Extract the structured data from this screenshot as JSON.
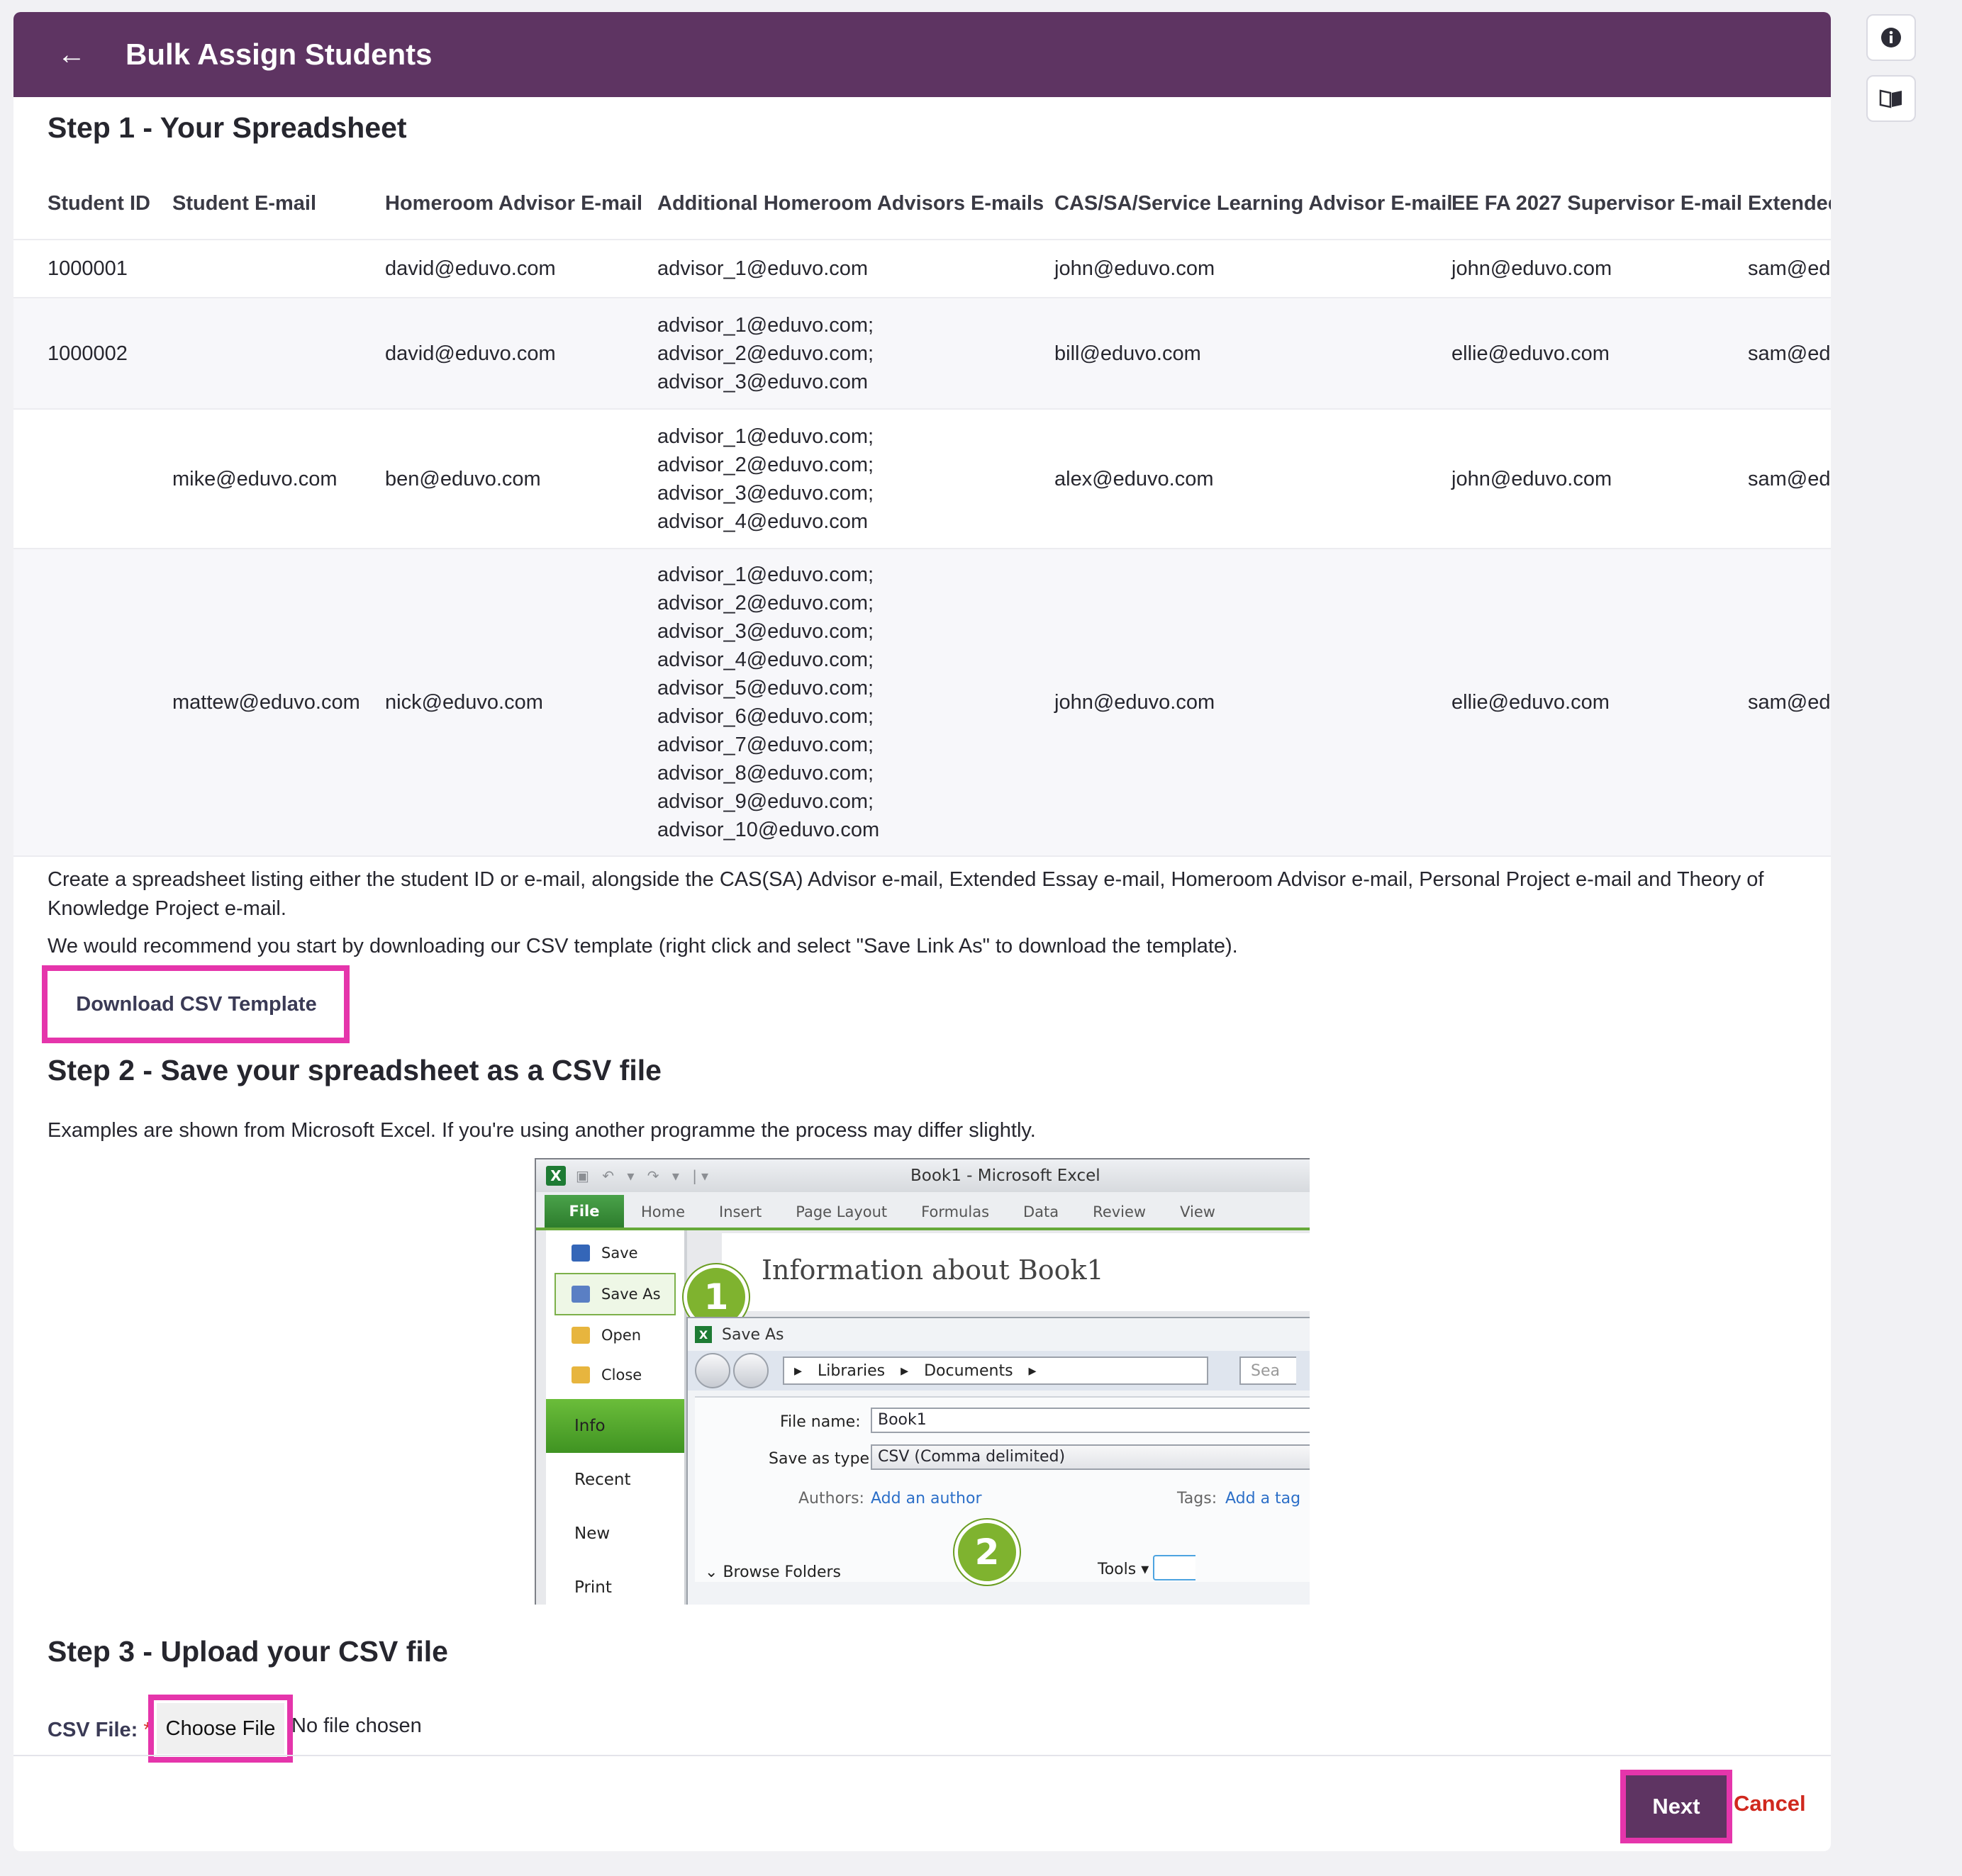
{
  "header": {
    "title": "Bulk Assign Students",
    "back_icon": "←"
  },
  "step1": {
    "title": "Step 1 - Your Spreadsheet"
  },
  "table": {
    "columns": [
      "Student ID",
      "Student E-mail",
      "Homeroom Advisor E-mail",
      "Additional Homeroom Advisors E-mails",
      "CAS/SA/Service Learning Advisor E-mail",
      "EE FA 2027 Supervisor E-mail",
      "Extended"
    ],
    "rows": [
      {
        "student_id": "1000001",
        "student_email": "",
        "homeroom": "david@eduvo.com",
        "additional": [
          "advisor_1@eduvo.com"
        ],
        "cas": "john@eduvo.com",
        "ee": "john@eduvo.com",
        "extended": "sam@edu"
      },
      {
        "student_id": "1000002",
        "student_email": "",
        "homeroom": "david@eduvo.com",
        "additional": [
          "advisor_1@eduvo.com;",
          "advisor_2@eduvo.com;",
          "advisor_3@eduvo.com"
        ],
        "cas": "bill@eduvo.com",
        "ee": "ellie@eduvo.com",
        "extended": "sam@edu"
      },
      {
        "student_id": "",
        "student_email": "mike@eduvo.com",
        "homeroom": "ben@eduvo.com",
        "additional": [
          "advisor_1@eduvo.com;",
          "advisor_2@eduvo.com;",
          "advisor_3@eduvo.com;",
          "advisor_4@eduvo.com"
        ],
        "cas": "alex@eduvo.com",
        "ee": "john@eduvo.com",
        "extended": "sam@edu"
      },
      {
        "student_id": "",
        "student_email": "mattew@eduvo.com",
        "homeroom": "nick@eduvo.com",
        "additional": [
          "advisor_1@eduvo.com;",
          "advisor_2@eduvo.com;",
          "advisor_3@eduvo.com;",
          "advisor_4@eduvo.com;",
          "advisor_5@eduvo.com;",
          "advisor_6@eduvo.com;",
          "advisor_7@eduvo.com;",
          "advisor_8@eduvo.com;",
          "advisor_9@eduvo.com;",
          "advisor_10@eduvo.com"
        ],
        "cas": "john@eduvo.com",
        "ee": "ellie@eduvo.com",
        "extended": "sam@edu"
      }
    ]
  },
  "instructions": {
    "p1": "Create a spreadsheet listing either the student ID or e-mail, alongside the CAS(SA) Advisor e-mail, Extended Essay e-mail, Homeroom Advisor e-mail, Personal Project e-mail and Theory of Knowledge Project e-mail.",
    "p2": "We would recommend you start by downloading our CSV template (right click and select \"Save Link As\" to download the template).",
    "download_label": "Download CSV Template"
  },
  "step2": {
    "title": "Step 2 - Save your spreadsheet as a CSV file",
    "desc": "Examples are shown from Microsoft Excel. If you're using another programme the process may differ slightly."
  },
  "excel": {
    "window_title": "Book1  -  Microsoft Excel",
    "logo": "X",
    "ribbon_tabs": [
      "File",
      "Home",
      "Insert",
      "Page Layout",
      "Formulas",
      "Data",
      "Review",
      "View"
    ],
    "menu": [
      "Save",
      "Save As",
      "Open",
      "Close"
    ],
    "side": [
      "Info",
      "Recent",
      "New",
      "Print"
    ],
    "info_title": "Information about Book1",
    "dialog_title": "Save As",
    "path": [
      "Libraries",
      "Documents"
    ],
    "search_hint": "Sea",
    "file_name_label": "File name:",
    "file_name": "Book1",
    "save_type_label": "Save as type:",
    "save_type": "CSV (Comma delimited)",
    "authors_label": "Authors:",
    "authors_link": "Add an author",
    "tags_label": "Tags:",
    "tags_link": "Add a tag",
    "browse": "Browse Folders",
    "tools": "Tools",
    "badge1": "1",
    "badge2": "2"
  },
  "step3": {
    "title": "Step 3 - Upload your CSV file",
    "file_label": "CSV File:",
    "required": "*",
    "choose_label": "Choose File",
    "no_file": "No file chosen"
  },
  "footer": {
    "next_label": "Next",
    "cancel_label": "Cancel"
  },
  "colors": {
    "header": "#5e3462",
    "highlight": "#e535ab",
    "cancel": "#d0281e",
    "excel_green": "#7fb32f"
  }
}
